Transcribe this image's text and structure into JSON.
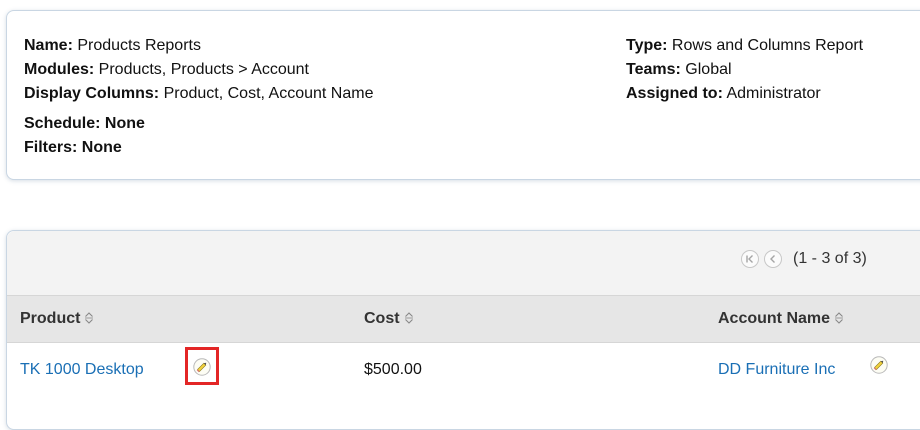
{
  "summary": {
    "name_label": "Name:",
    "name_value": " Products Reports",
    "modules_label": "Modules:",
    "modules_value": " Products, Products > Account",
    "display_columns_label": "Display Columns:",
    "display_columns_value": " Product, Cost, Account Name",
    "schedule_label": "Schedule:",
    "schedule_value": " None",
    "filters_label": "Filters:",
    "filters_value": " None",
    "type_label": "Type:",
    "type_value": " Rows and Columns Report",
    "teams_label": "Teams:",
    "teams_value": " Global",
    "assigned_label": "Assigned to:",
    "assigned_value": " Administrator"
  },
  "pager": {
    "first_icon": "first-page-icon",
    "prev_icon": "previous-page-icon",
    "range_text": "(1 - 3 of 3)"
  },
  "table": {
    "columns": [
      "Product",
      "Cost",
      "Account Name"
    ],
    "rows": [
      {
        "product": "TK 1000 Desktop",
        "cost": "$500.00",
        "account_name": "DD Furniture Inc"
      }
    ]
  },
  "colors": {
    "link": "#1a6fb5",
    "highlight": "#e32626",
    "pencil_fill": "#f2d23c"
  }
}
